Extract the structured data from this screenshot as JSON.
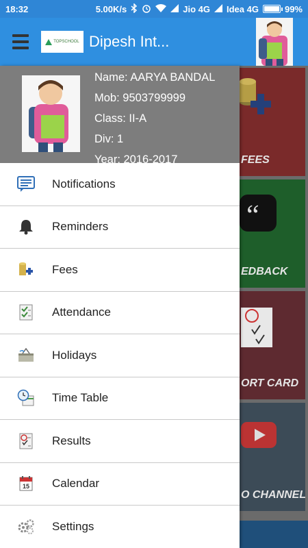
{
  "status_bar": {
    "time": "18:32",
    "network_speed": "5.00K/s",
    "carrier1": "Jio 4G",
    "carrier2": "Idea 4G",
    "battery": "99%"
  },
  "app_bar": {
    "title": "Dipesh Int...",
    "logo_text": "TOPSCHOOL"
  },
  "profile": {
    "name": "Name: AARYA BANDAL",
    "mob": "Mob: 9503799999",
    "class": "Class: II-A",
    "div": "Div: 1",
    "year": "Year: 2016-2017"
  },
  "menu": [
    {
      "label": "Notifications",
      "icon": "notifications-icon"
    },
    {
      "label": "Reminders",
      "icon": "bell-icon"
    },
    {
      "label": "Fees",
      "icon": "coins-icon"
    },
    {
      "label": "Attendance",
      "icon": "attendance-icon"
    },
    {
      "label": "Holidays",
      "icon": "holidays-icon"
    },
    {
      "label": "Time Table",
      "icon": "clock-calendar-icon"
    },
    {
      "label": "Results",
      "icon": "results-icon"
    },
    {
      "label": "Calendar",
      "icon": "calendar-icon"
    },
    {
      "label": "Settings",
      "icon": "gears-icon"
    }
  ],
  "tiles": {
    "fees": "FEES",
    "feedback": "EDBACK",
    "report_card": "ORT CARD",
    "video_channel": "O CHANNEL"
  }
}
